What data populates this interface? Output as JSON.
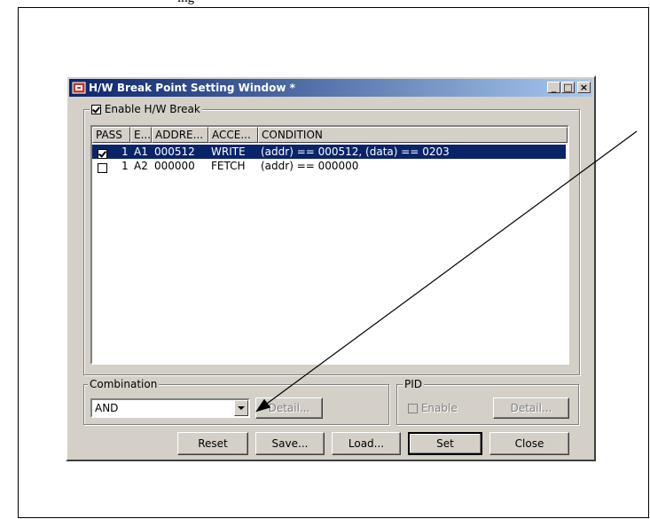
{
  "window": {
    "title": "H/W Break Point Setting Window *",
    "minimize_label": "_",
    "maximize_label": "□",
    "close_label": "×"
  },
  "top_text": "ing",
  "enable_group": {
    "label": "Enable H/W Break",
    "checked": true
  },
  "table": {
    "columns": [
      "PASS",
      "E...",
      "ADDRE...",
      "ACCE...",
      "CONDITION"
    ],
    "rows": [
      {
        "checked": true,
        "pass": "1",
        "event": "A1",
        "address": "000512",
        "access": "WRITE",
        "condition": "(addr) == 000512, (data) == 0203",
        "selected": true
      },
      {
        "checked": false,
        "pass": "1",
        "event": "A2",
        "address": "000000",
        "access": "FETCH",
        "condition": "(addr) == 000000",
        "selected": false
      }
    ]
  },
  "combination": {
    "label": "Combination",
    "value": "AND",
    "detail_label": "Detail..."
  },
  "pid": {
    "label": "PID",
    "enable_label": "Enable",
    "detail_label": "Detail..."
  },
  "buttons": {
    "reset": "Reset",
    "save": "Save...",
    "load": "Load...",
    "set": "Set",
    "close": "Close"
  },
  "colors": {
    "titlebar_start": "#0a246a",
    "titlebar_end": "#a6caf0",
    "selection": "#0a246a",
    "window_bg": "#d4d0c8"
  }
}
